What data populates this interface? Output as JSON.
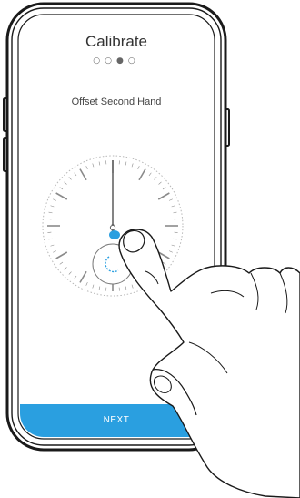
{
  "screen": {
    "title": "Calibrate",
    "step_indicator": "○○●○",
    "subtitle": "Offset Second Hand",
    "next_label": "NEXT",
    "progress": {
      "total_steps": 4,
      "current_step": 3
    }
  },
  "watch": {
    "second_hand_reading": 0,
    "sub_dial_hand_reading": 0
  },
  "colors": {
    "accent": "#2a9fe0",
    "phone_outline": "#1a1a1a",
    "tick": "#8a8a8a",
    "text": "#333333"
  }
}
